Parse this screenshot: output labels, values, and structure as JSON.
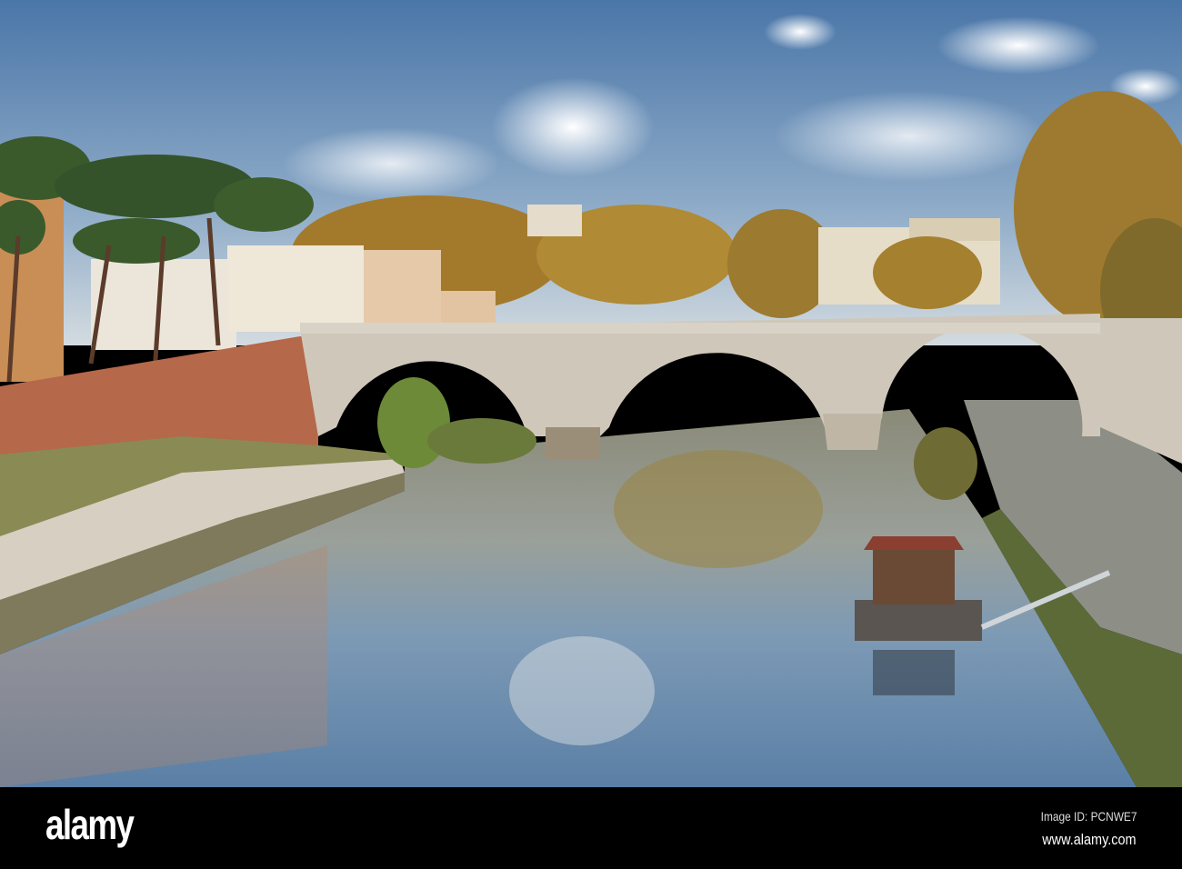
{
  "watermark": {
    "logo_text": "alamy",
    "image_id": "Image ID: PCNWE7",
    "url": "www.alamy.com"
  },
  "colors": {
    "sky_top": "#4d78a8",
    "sky_bottom": "#c9d6e0",
    "water": "#6f8fae",
    "bridge_stone": "#cfc8bb",
    "foliage": "#b4852e",
    "pine": "#3d5a2e",
    "brick": "#b56a4a"
  }
}
